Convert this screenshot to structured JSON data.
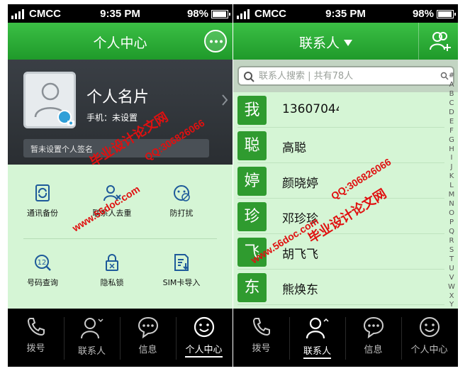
{
  "status_bar": {
    "carrier": "CMCC",
    "time": "9:35 PM",
    "battery": "98%",
    "battery_level": 0.98,
    "signal_bars": 4
  },
  "left": {
    "title": "个人中心",
    "more_icon": "more-dots-icon",
    "profile": {
      "name": "个人名片",
      "phone": "手机：未设置",
      "signature": "暂未设置个人签名"
    },
    "features": [
      {
        "label": "通讯备份",
        "icon": "backup-icon"
      },
      {
        "label": "联系人去重",
        "icon": "dedup-icon"
      },
      {
        "label": "防打扰",
        "icon": "no-disturb-icon"
      },
      {
        "label": "号码查询",
        "icon": "number-lookup-icon"
      },
      {
        "label": "隐私锁",
        "icon": "privacy-lock-icon"
      },
      {
        "label": "SIM卡导入",
        "icon": "sim-import-icon"
      }
    ],
    "nav": [
      {
        "label": "拨号",
        "icon": "phone-icon",
        "active": false
      },
      {
        "label": "联系人",
        "icon": "contacts-icon",
        "active": false
      },
      {
        "label": "信息",
        "icon": "message-icon",
        "active": false
      },
      {
        "label": "个人中心",
        "icon": "profile-center-icon",
        "active": true
      }
    ]
  },
  "right": {
    "title": "联系人",
    "add_icon": "add-contact-icon",
    "search": {
      "placeholder": "联系人搜索 | 共有78人"
    },
    "contacts": [
      {
        "avatar": "我",
        "name": "13607044"
      },
      {
        "avatar": "聪",
        "name": "高聪"
      },
      {
        "avatar": "婷",
        "name": "颜晓婷"
      },
      {
        "avatar": "珍",
        "name": "邓珍珍"
      },
      {
        "avatar": "飞",
        "name": "胡飞飞"
      },
      {
        "avatar": "东",
        "name": "熊焕东"
      }
    ],
    "index_letters": [
      "#",
      "A",
      "B",
      "C",
      "D",
      "E",
      "F",
      "G",
      "H",
      "I",
      "J",
      "K",
      "L",
      "M",
      "N",
      "O",
      "P",
      "Q",
      "R",
      "S",
      "T",
      "U",
      "V",
      "W",
      "X",
      "Y",
      "Z"
    ],
    "nav": [
      {
        "label": "拨号",
        "icon": "phone-icon",
        "active": false
      },
      {
        "label": "联系人",
        "icon": "contacts-icon",
        "active": true
      },
      {
        "label": "信息",
        "icon": "message-icon",
        "active": false
      },
      {
        "label": "个人中心",
        "icon": "profile-center-icon",
        "active": false
      }
    ]
  },
  "watermark": {
    "site": "www.56doc.com",
    "qq": "QQ:306826066",
    "text": "毕业设计论文网"
  },
  "colors": {
    "header_green": "#2aa835",
    "list_bg": "#d5f5d5",
    "avatar_green": "#2f9b2f",
    "watermark_red": "#e01010"
  }
}
